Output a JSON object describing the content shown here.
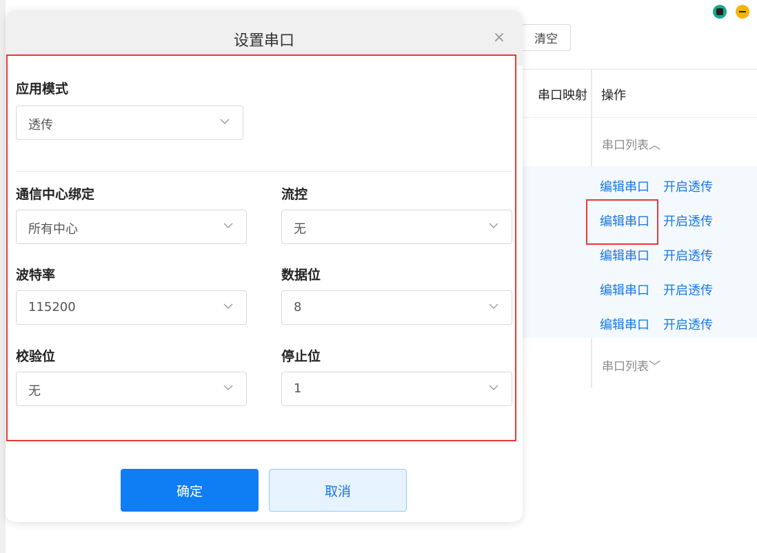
{
  "background": {
    "clear_button": "清空",
    "table_headers": {
      "mapping": "串口映射",
      "operation": "操作"
    },
    "serial_list_toggle_top": "串口列表︿",
    "serial_list_toggle_bottom": "串口列表﹀",
    "rows": [
      {
        "edit": "编辑串口",
        "passthrough": "开启透传"
      },
      {
        "edit": "编辑串口",
        "passthrough": "开启透传"
      },
      {
        "edit": "编辑串口",
        "passthrough": "开启透传"
      },
      {
        "edit": "编辑串口",
        "passthrough": "开启透传"
      },
      {
        "edit": "编辑串口",
        "passthrough": "开启透传"
      }
    ]
  },
  "modal": {
    "title": "设置串口",
    "close_icon": "×",
    "app_mode": {
      "label": "应用模式",
      "value": "透传"
    },
    "comm_center": {
      "label": "通信中心绑定",
      "value": "所有中心"
    },
    "flow_control": {
      "label": "流控",
      "value": "无"
    },
    "baud_rate": {
      "label": "波特率",
      "value": "115200"
    },
    "data_bits": {
      "label": "数据位",
      "value": "8"
    },
    "parity": {
      "label": "校验位",
      "value": "无"
    },
    "stop_bits": {
      "label": "停止位",
      "value": "1"
    },
    "confirm_button": "确定",
    "cancel_button": "取消"
  },
  "colors": {
    "primary": "#0f7ef5",
    "link": "#1677e6",
    "highlight": "#e53935"
  }
}
